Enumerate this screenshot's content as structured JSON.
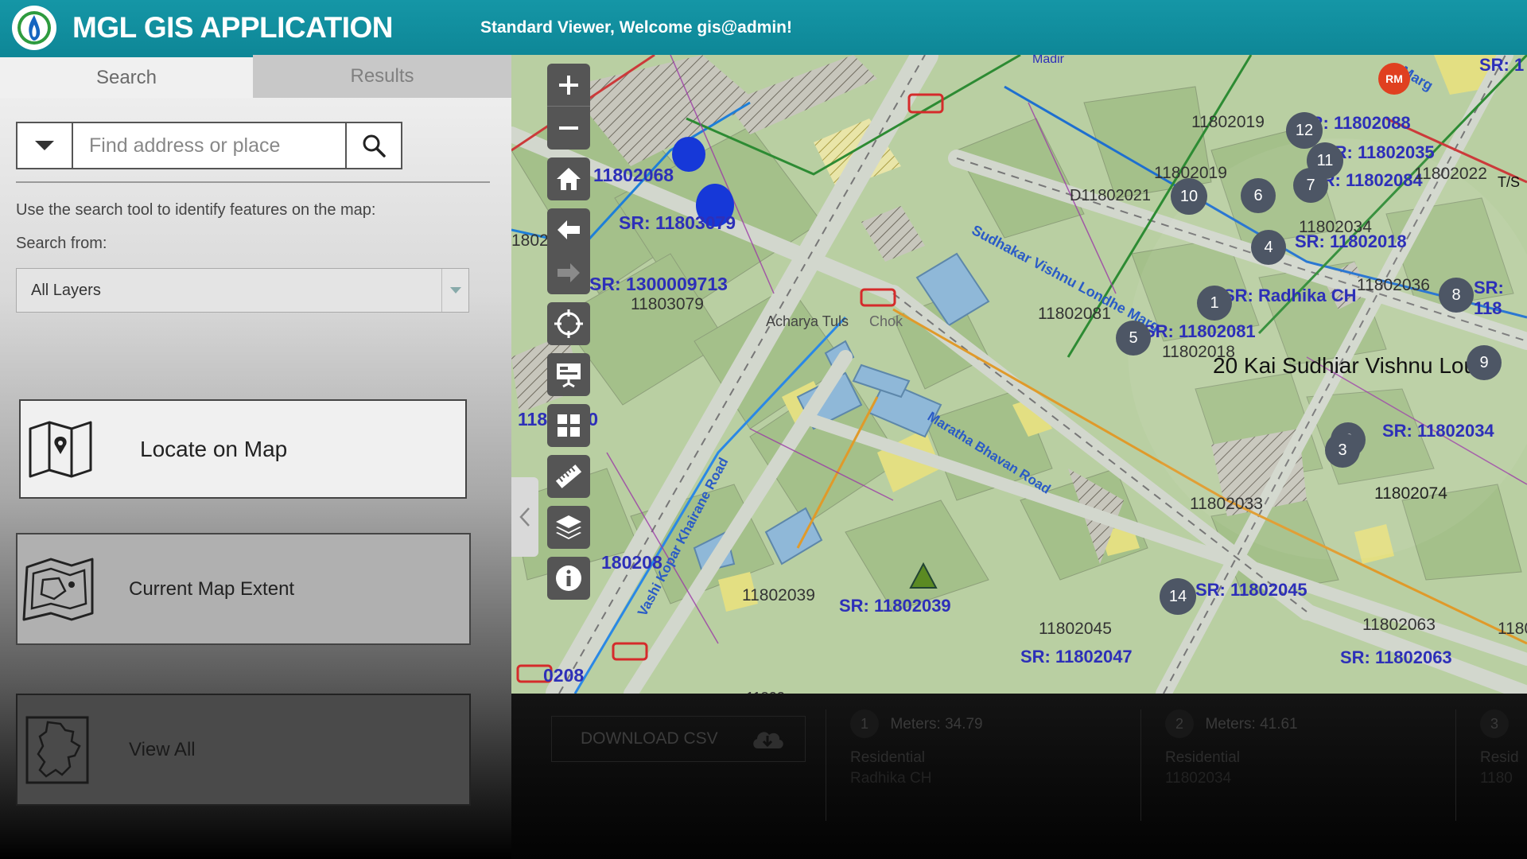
{
  "header": {
    "title": "MGL GIS APPLICATION",
    "welcome": "Standard Viewer, Welcome gis@admin!",
    "brand_color": "#0e8797"
  },
  "sidebar": {
    "tabs": [
      {
        "label": "Search",
        "active": true
      },
      {
        "label": "Results",
        "active": false
      }
    ],
    "search": {
      "placeholder": "Find address or place",
      "value": ""
    },
    "hint": "Use the search tool to identify features on the map:",
    "search_from_label": "Search from:",
    "layer_select": {
      "selected": "All Layers"
    },
    "buttons": {
      "locate": "Locate on Map",
      "extent": "Current Map Extent",
      "view_all": "View All"
    }
  },
  "map": {
    "labels": {
      "sr_11802068": "11802068",
      "sr_11803079": "SR: 11803079",
      "sr_13000097": "SR: 1300009713",
      "plain_11803079": "11803079",
      "acharya": "Acharya Tuls",
      "chok": "Chok",
      "sr_11802080": "11802080",
      "sr_180208": "180208",
      "sr_0208": "0208",
      "plain_11802039": "11802039",
      "sr_1802039": "SR: 11802039",
      "road_sudhakar": "Sudhakar Vishnu Londhe Marg",
      "road_maratha": "Maratha Bhavan Road",
      "road_khairane": "Vashi Kopar Khairane Road",
      "plain_11802081": "11802081",
      "sr_11802081": "SR: 11802081",
      "plain_11802018": "11802018",
      "address": "20 Kai Sudhiar Vishnu Loud",
      "plain_11802019a": "11802019",
      "plain_11802019b": "11802019",
      "d_11802021": "D11802021",
      "sr_11802088": "SR: 11802088",
      "sr_11802035": "SR: 11802035",
      "sr_11802084": "SR: 11802084",
      "plain_11802034": "11802034",
      "sr_11802018": "SR: 11802018",
      "sr_radhika": "SR: Radhika CH",
      "plain_11802036": "11802036",
      "sr_11802034": "SR: 11802034",
      "plain_11802074": "11802074",
      "plain_11802033": "11802033",
      "sr_11802045": "SR: 11802045",
      "plain_11802045": "11802045",
      "sr_11802047": "SR: 11802047",
      "plain_11802063": "11802063",
      "sr_11802063": "SR: 11802063",
      "plain_11802022": "11802022",
      "ts": "T/S",
      "madir": "Madir",
      "sr_1": "SR: 1",
      "sr_118": "SR: 118",
      "marg": "Marg",
      "plain_1802": "1802",
      "plain_1180": "1180",
      "plain_18022": "11802",
      "rm": "RM"
    },
    "markers": [
      "1",
      "2",
      "3",
      "4",
      "5",
      "6",
      "7",
      "8",
      "9",
      "10",
      "11",
      "12",
      "14"
    ],
    "tools": [
      "zoom-in",
      "zoom-out",
      "home",
      "back",
      "forward",
      "locate",
      "basemap",
      "grid",
      "measure",
      "layers",
      "info"
    ]
  },
  "attributes": {
    "download_label": "DOWNLOAD CSV",
    "cards": [
      {
        "num": "1",
        "meters": "Meters: 34.79",
        "usage": "Residential",
        "sr": "Radhika CH"
      },
      {
        "num": "2",
        "meters": "Meters: 41.61",
        "usage": "Residential",
        "sr": "11802034"
      },
      {
        "num": "3",
        "meters": "",
        "usage": "Resid",
        "sr": "1180"
      }
    ]
  }
}
